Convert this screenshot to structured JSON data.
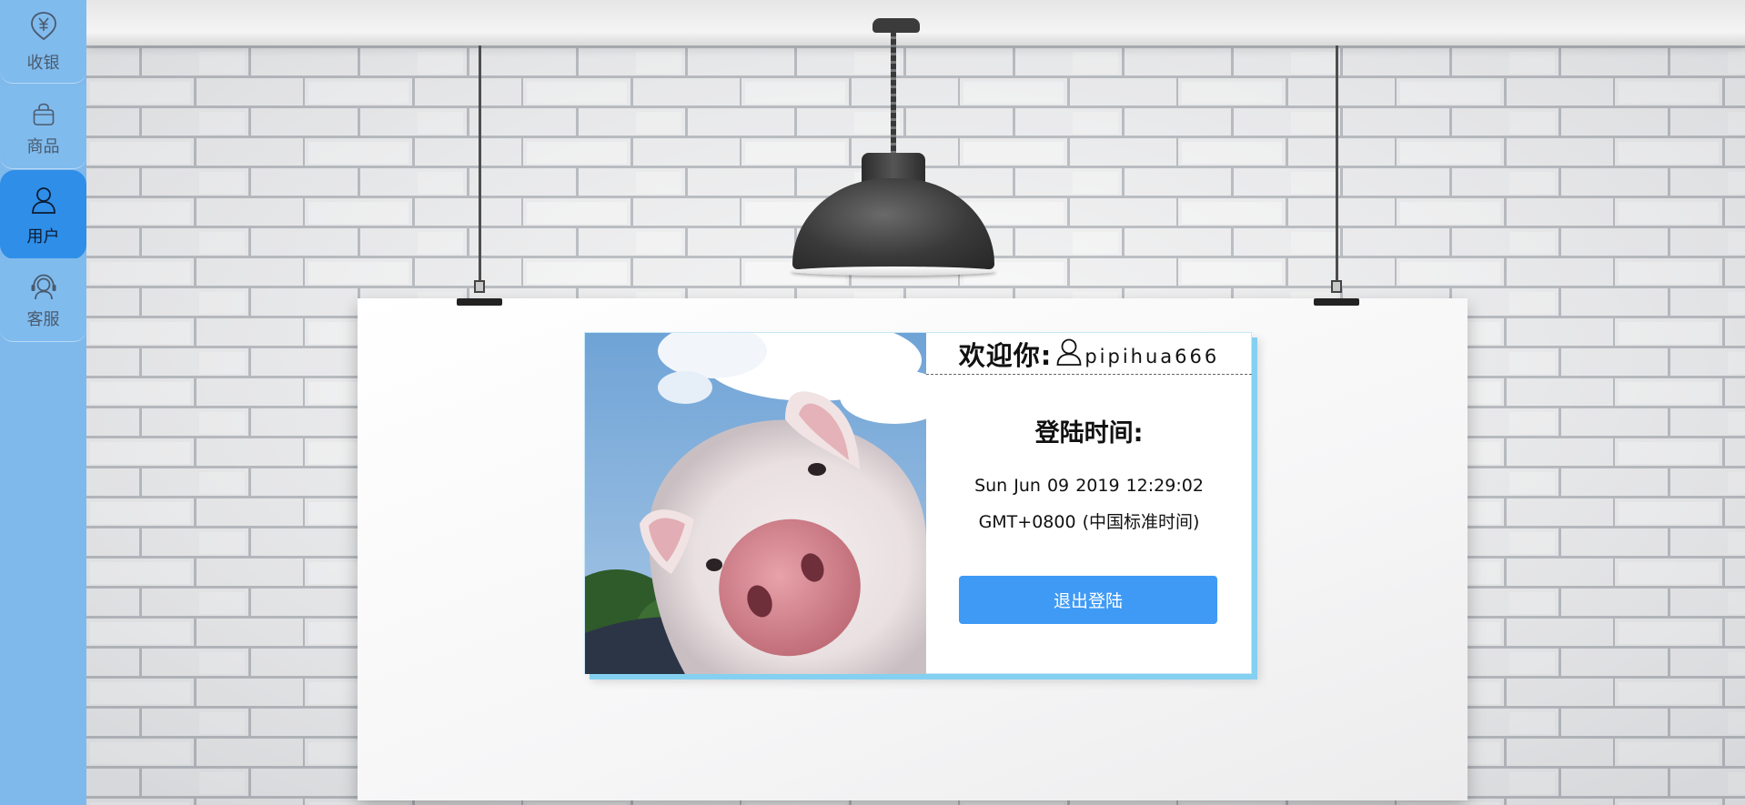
{
  "sidebar": {
    "items": [
      {
        "label": "收银",
        "icon": "cashier-icon",
        "active": false
      },
      {
        "label": "商品",
        "icon": "shopping-bag-icon",
        "active": false
      },
      {
        "label": "用户",
        "icon": "user-icon",
        "active": true
      },
      {
        "label": "客服",
        "icon": "headset-icon",
        "active": false
      }
    ]
  },
  "user_panel": {
    "welcome_label": "欢迎你:",
    "username": "pipihua666",
    "login_time_label": "登陆时间:",
    "login_time_value": "Sun Jun 09 2019 12:29:02 GMT+0800 (中国标准时间)",
    "logout_label": "退出登陆"
  },
  "colors": {
    "sidebar_bg": "#7fb9ec",
    "sidebar_active": "#2f8ee8",
    "card_shadow": "#84d0f0",
    "button": "#3f9af5"
  }
}
